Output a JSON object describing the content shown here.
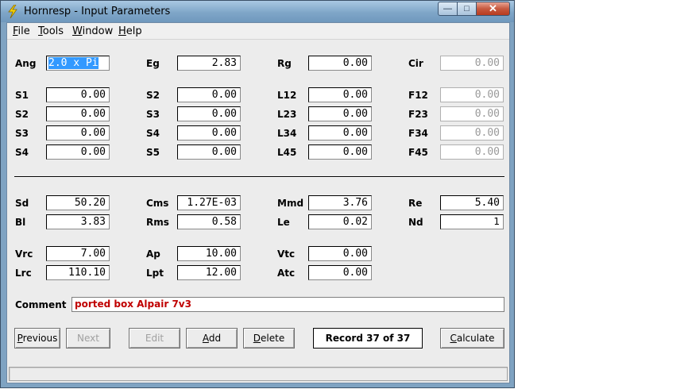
{
  "window": {
    "title": "Hornresp - Input Parameters",
    "minimize_glyph": "—",
    "maximize_glyph": "□",
    "close_glyph": "✕",
    "icon": "lightning-bolt-icon"
  },
  "menu": [
    {
      "label": "File",
      "accel": "F",
      "rest": "ile"
    },
    {
      "label": "Tools",
      "accel": "T",
      "rest": "ools"
    },
    {
      "label": "Window",
      "accel": "W",
      "rest": "indow"
    },
    {
      "label": "Help",
      "accel": "H",
      "rest": "elp"
    }
  ],
  "params": {
    "ang": {
      "label": "Ang",
      "value": "2.0 x Pi"
    },
    "eg": {
      "label": "Eg",
      "value": "2.83"
    },
    "rg": {
      "label": "Rg",
      "value": "0.00"
    },
    "cir": {
      "label": "Cir",
      "value": "0.00"
    },
    "s1": {
      "label": "S1",
      "value": "0.00"
    },
    "s2a": {
      "label": "S2",
      "value": "0.00"
    },
    "l12": {
      "label": "L12",
      "value": "0.00"
    },
    "f12": {
      "label": "F12",
      "value": "0.00"
    },
    "s2": {
      "label": "S2",
      "value": "0.00"
    },
    "s3a": {
      "label": "S3",
      "value": "0.00"
    },
    "l23": {
      "label": "L23",
      "value": "0.00"
    },
    "f23": {
      "label": "F23",
      "value": "0.00"
    },
    "s3": {
      "label": "S3",
      "value": "0.00"
    },
    "s4a": {
      "label": "S4",
      "value": "0.00"
    },
    "l34": {
      "label": "L34",
      "value": "0.00"
    },
    "f34": {
      "label": "F34",
      "value": "0.00"
    },
    "s4": {
      "label": "S4",
      "value": "0.00"
    },
    "s5": {
      "label": "S5",
      "value": "0.00"
    },
    "l45": {
      "label": "L45",
      "value": "0.00"
    },
    "f45": {
      "label": "F45",
      "value": "0.00"
    },
    "sd": {
      "label": "Sd",
      "value": "50.20"
    },
    "cms": {
      "label": "Cms",
      "value": "1.27E-03"
    },
    "mmd": {
      "label": "Mmd",
      "value": "3.76"
    },
    "re": {
      "label": "Re",
      "value": "5.40"
    },
    "bl": {
      "label": "Bl",
      "value": "3.83"
    },
    "rms": {
      "label": "Rms",
      "value": "0.58"
    },
    "le": {
      "label": "Le",
      "value": "0.02"
    },
    "nd": {
      "label": "Nd",
      "value": "1"
    },
    "vrc": {
      "label": "Vrc",
      "value": "7.00"
    },
    "ap": {
      "label": "Ap",
      "value": "10.00"
    },
    "vtc": {
      "label": "Vtc",
      "value": "0.00"
    },
    "lrc": {
      "label": "Lrc",
      "value": "110.10"
    },
    "lpt": {
      "label": "Lpt",
      "value": "12.00"
    },
    "atc": {
      "label": "Atc",
      "value": "0.00"
    }
  },
  "comment": {
    "label": "Comment",
    "value": "ported box Alpair 7v3"
  },
  "buttons": {
    "previous": {
      "accel": "P",
      "rest": "revious"
    },
    "next": {
      "label": "Next"
    },
    "edit": {
      "label": "Edit"
    },
    "add": {
      "accel": "A",
      "rest": "dd"
    },
    "delete": {
      "accel": "D",
      "rest": "elete"
    },
    "calculate": {
      "accel": "C",
      "rest": "alculate"
    }
  },
  "record": "Record 37 of 37",
  "status_text": ""
}
